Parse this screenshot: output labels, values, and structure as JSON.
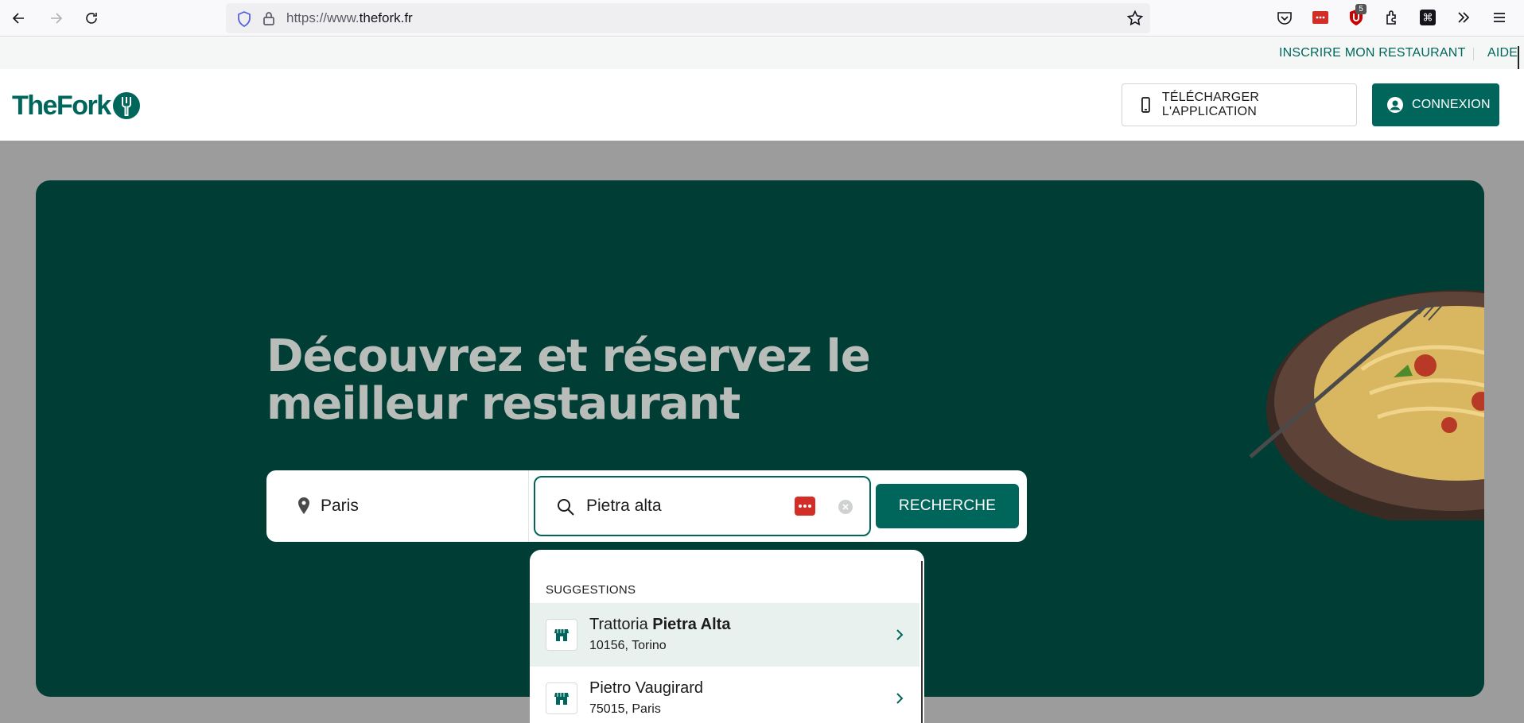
{
  "browser": {
    "url_prefix": "https://www.",
    "url_domain": "thefork.fr",
    "extension_badge": "5"
  },
  "utility_nav": {
    "register_restaurant": "INSCRIRE MON RESTAURANT",
    "help": "AIDE"
  },
  "header": {
    "logo_text": "TheFork",
    "download_app_label": "TÉLÉCHARGER L'APPLICATION",
    "login_label": "CONNEXION"
  },
  "hero": {
    "title": "Découvrez et réservez le meilleur restaurant"
  },
  "search": {
    "location_value": "Paris",
    "query_value": "Pietra alta",
    "button_label": "RECHERCHE"
  },
  "suggestions": {
    "header": "SUGGESTIONS",
    "items": [
      {
        "title_prefix": "Trattoria ",
        "title_match": "Pietra Alta",
        "subtitle": "10156, Torino"
      },
      {
        "title_prefix": "Pietro Vaugirard",
        "title_match": "",
        "subtitle": "75015, Paris"
      }
    ]
  },
  "colors": {
    "brand": "#00665c",
    "hero_bg": "#003d34",
    "overlay": "#9c9c9c"
  },
  "icons": [
    "back-arrow-icon",
    "forward-arrow-icon",
    "reload-icon",
    "shield-icon",
    "lock-icon",
    "star-icon",
    "pocket-icon",
    "password-manager-icon",
    "ublock-icon",
    "extensions-icon",
    "command-icon",
    "overflow-icon",
    "menu-icon",
    "phone-icon",
    "user-icon",
    "location-pin-icon",
    "search-icon",
    "clear-icon",
    "restaurant-icon",
    "chevron-right-icon"
  ]
}
